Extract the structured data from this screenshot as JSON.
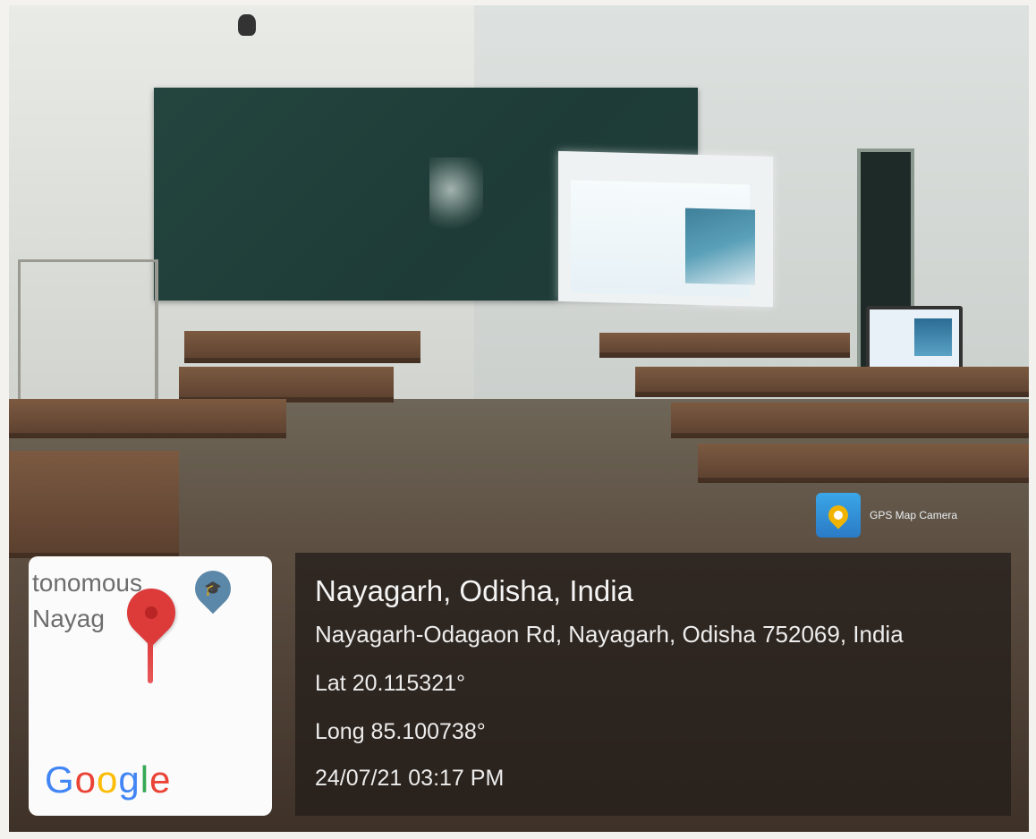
{
  "location": {
    "title": "Nayagarh, Odisha, India",
    "address": "Nayagarh-Odagaon Rd, Nayagarh, Odisha 752069, India",
    "lat": "Lat 20.115321°",
    "long": "Long 85.100738°",
    "datetime": "24/07/21 03:17 PM"
  },
  "map": {
    "label_line1": "tonomous",
    "label_line2": "Nayag",
    "logo_text": "Google"
  },
  "badge": {
    "app_name": "GPS Map Camera"
  },
  "colors": {
    "pin_red": "#dd3a3a",
    "overlay_bg": "#241e1a",
    "google_blue": "#4285F4",
    "google_red": "#EA4335",
    "google_yellow": "#FBBC05",
    "google_green": "#34A853"
  }
}
